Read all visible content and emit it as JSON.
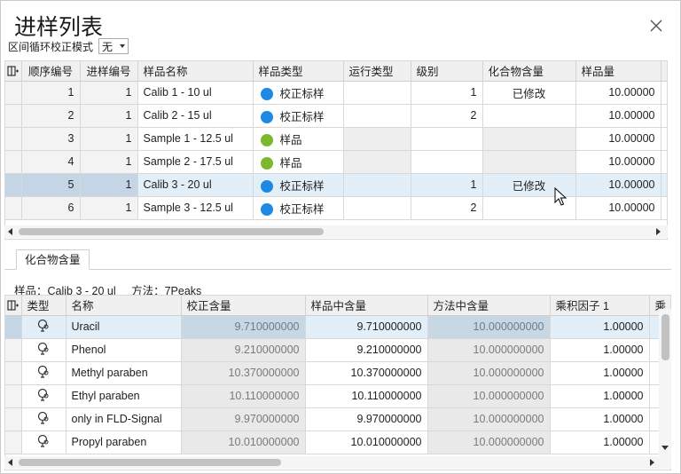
{
  "window": {
    "title": "进样列表"
  },
  "mode": {
    "label": "区间循环校正模式",
    "value": "无"
  },
  "sequence": {
    "columns": [
      "顺序编号",
      "进样编号",
      "样品名称",
      "样品类型",
      "运行类型",
      "级别",
      "化合物含量",
      "样品量"
    ],
    "rows": [
      {
        "order": "1",
        "inj": "1",
        "name": "Calib 1 - 10 ul",
        "type": "校正标样",
        "run": "",
        "level": "1",
        "compound": "已修改",
        "amount": "10.00000"
      },
      {
        "order": "2",
        "inj": "1",
        "name": "Calib 2 - 15 ul",
        "type": "校正标样",
        "run": "",
        "level": "2",
        "compound": "",
        "amount": "10.00000"
      },
      {
        "order": "3",
        "inj": "1",
        "name": "Sample 1 - 12.5 ul",
        "type": "样品",
        "run": "",
        "level": "",
        "compound": "",
        "amount": "10.00000"
      },
      {
        "order": "4",
        "inj": "1",
        "name": "Sample 2 - 17.5 ul",
        "type": "样品",
        "run": "",
        "level": "",
        "compound": "",
        "amount": "10.00000"
      },
      {
        "order": "5",
        "inj": "1",
        "name": "Calib 3 - 20 ul",
        "type": "校正标样",
        "run": "",
        "level": "1",
        "compound": "已修改",
        "amount": "10.00000"
      },
      {
        "order": "6",
        "inj": "1",
        "name": "Sample 3 - 12.5 ul",
        "type": "校正标样",
        "run": "",
        "level": "2",
        "compound": "",
        "amount": "10.00000"
      }
    ]
  },
  "colors": {
    "calibration": "#1e88e5",
    "sample": "#7cb82f"
  },
  "tab": {
    "label": "化合物含量"
  },
  "info": {
    "sample": "样品：Calib 3 - 20 ul",
    "method": "方法：7Peaks"
  },
  "compounds": {
    "columns": [
      "类型",
      "名称",
      "校正含量",
      "样品中含量",
      "方法中含量",
      "乘积因子 1",
      "乘"
    ],
    "rows": [
      {
        "name": "Uracil",
        "cal": "9.710000000",
        "sample": "9.710000000",
        "method": "10.000000000",
        "factor": "1.00000"
      },
      {
        "name": "Phenol",
        "cal": "9.210000000",
        "sample": "9.210000000",
        "method": "10.000000000",
        "factor": "1.00000"
      },
      {
        "name": "Methyl paraben",
        "cal": "10.370000000",
        "sample": "10.370000000",
        "method": "10.000000000",
        "factor": "1.00000"
      },
      {
        "name": "Ethyl paraben",
        "cal": "10.110000000",
        "sample": "10.110000000",
        "method": "10.000000000",
        "factor": "1.00000"
      },
      {
        "name": "only in FLD-Signal",
        "cal": "9.970000000",
        "sample": "9.970000000",
        "method": "10.000000000",
        "factor": "1.00000"
      },
      {
        "name": "Propyl paraben",
        "cal": "10.010000000",
        "sample": "10.010000000",
        "method": "10.000000000",
        "factor": "1.00000"
      }
    ]
  }
}
